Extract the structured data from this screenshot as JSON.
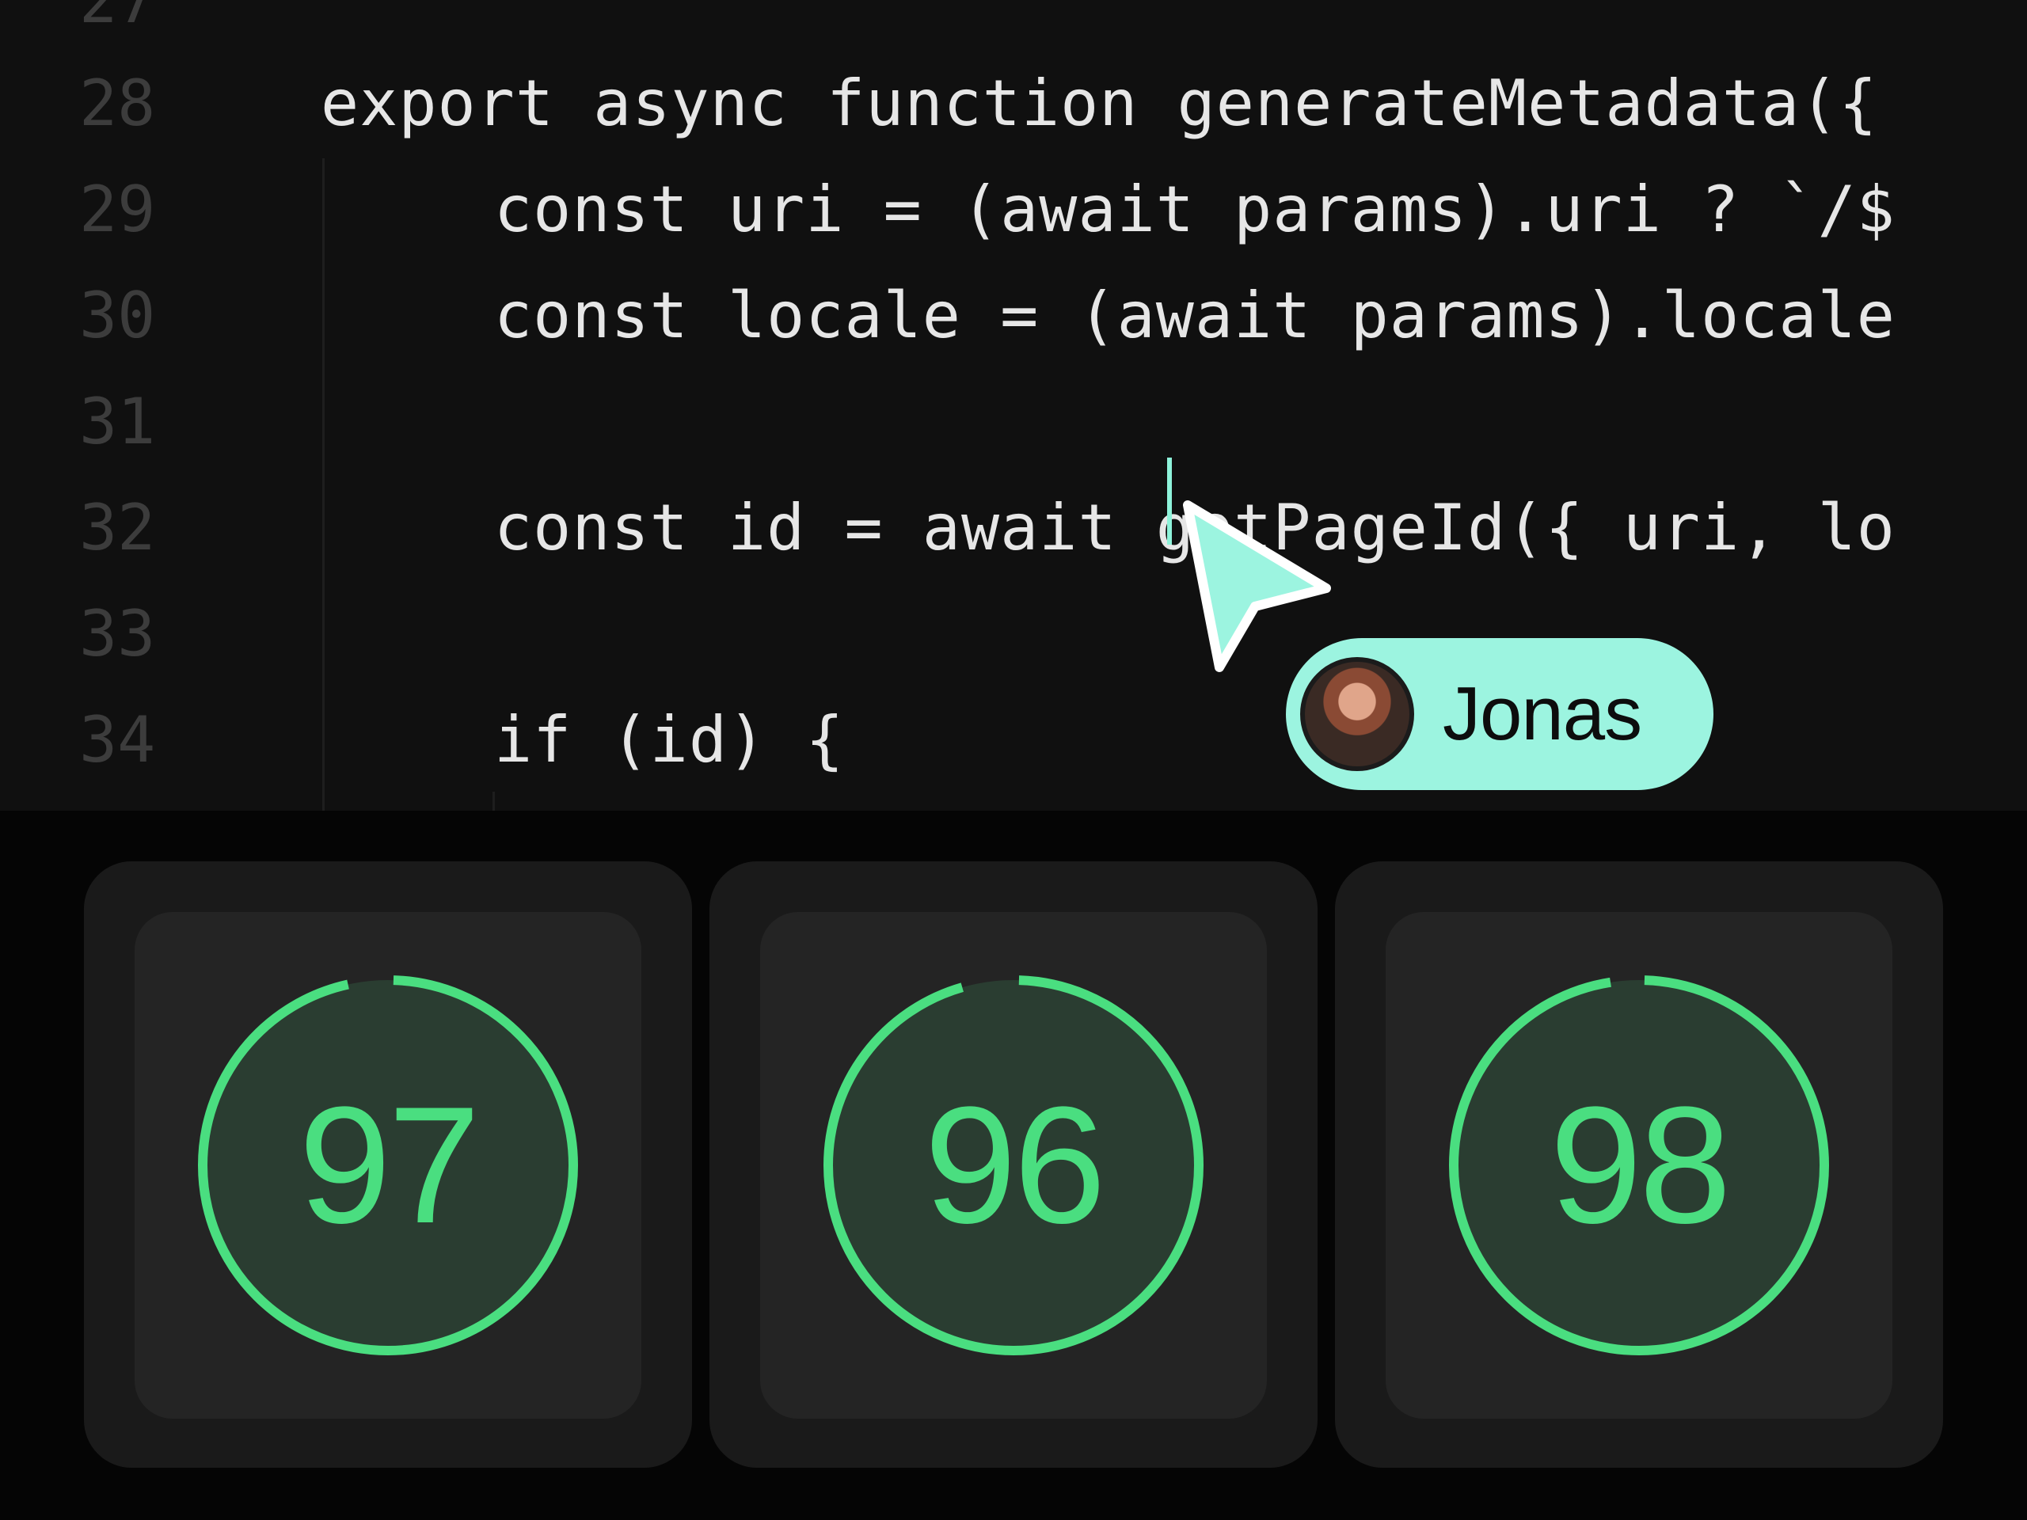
{
  "editor": {
    "lines": [
      {
        "num": "27",
        "code": ""
      },
      {
        "num": "28",
        "code": "export async function generateMetadata({"
      },
      {
        "num": "29",
        "code": "const uri = (await params).uri ? `/$"
      },
      {
        "num": "30",
        "code": "const locale = (await params).locale"
      },
      {
        "num": "31",
        "code": ""
      },
      {
        "num": "32",
        "code": "const id = await getPageId({ uri, lo"
      },
      {
        "num": "33",
        "code": ""
      },
      {
        "num": "34",
        "code": "if (id) {"
      }
    ]
  },
  "collaborator": {
    "name": "Jonas",
    "color": "#9cf4e0"
  },
  "scores": [
    {
      "value": "97",
      "fraction": 0.97
    },
    {
      "value": "96",
      "fraction": 0.96
    },
    {
      "value": "98",
      "fraction": 0.98
    }
  ],
  "colors": {
    "accent": "#4ade80",
    "track": "#2a3d31"
  }
}
